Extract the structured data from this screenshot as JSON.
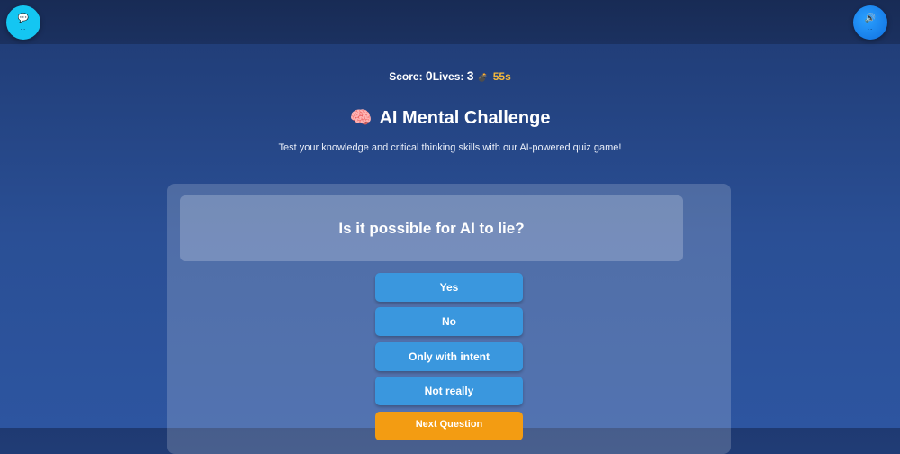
{
  "topbar": {
    "left_button": {
      "glyph": "💬",
      "dots": "..",
      "icon": "chat-bubble-icon"
    },
    "right_button": {
      "glyph": "🔊",
      "dots": "..",
      "icon": "speaker-icon"
    }
  },
  "status": {
    "score_label": "Score: ",
    "score_value": "0",
    "lives_label": "Lives: ",
    "lives_value": "3",
    "bomb_icon": "💣",
    "timer": "55s"
  },
  "header": {
    "brain_icon": "🧠",
    "title": "AI Mental Challenge",
    "subtitle": "Test your knowledge and critical thinking skills with our AI-powered quiz game!"
  },
  "quiz": {
    "question": "Is it possible for AI to lie?",
    "answers": [
      "Yes",
      "No",
      "Only with intent",
      "Not really"
    ],
    "next_label": "Next Question"
  },
  "colors": {
    "answer_button": "#3a97de",
    "next_button": "#f39c12",
    "timer": "#f6b93b"
  }
}
